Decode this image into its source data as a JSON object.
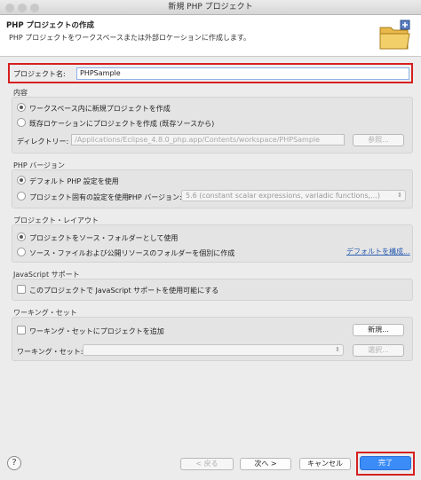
{
  "window": {
    "title": "新規 PHP プロジェクト"
  },
  "header": {
    "title": "PHP プロジェクトの作成",
    "description": "PHP プロジェクトをワークスペースまたは外部ロケーションに作成します。"
  },
  "project_name": {
    "label": "プロジェクト名:",
    "value": "PHPSample"
  },
  "contents": {
    "title": "内容",
    "options": [
      {
        "label": "ワークスペース内に新規プロジェクトを作成",
        "selected": true
      },
      {
        "label": "既存ロケーションにプロジェクトを作成 (既存ソースから)",
        "selected": false
      }
    ],
    "directory_label": "ディレクトリー:",
    "directory_value": "/Applications/Eclipse_4.8.0_php.app/Contents/workspace/PHPSample",
    "browse_label": "参照..."
  },
  "php_version": {
    "title": "PHP バージョン",
    "options": [
      {
        "label": "デフォルト PHP 設定を使用",
        "selected": true
      },
      {
        "label": "プロジェクト固有の設定を使用:",
        "selected": false
      }
    ],
    "version_label": "PHP バージョン:",
    "version_value": "5.6 (constant scalar expressions, variadic functions,...)"
  },
  "layout": {
    "title": "プロジェクト・レイアウト",
    "options": [
      {
        "label": "プロジェクトをソース・フォルダーとして使用",
        "selected": true
      },
      {
        "label": "ソース・ファイルおよび公開リソースのフォルダーを個別に作成",
        "selected": false
      }
    ],
    "configure_link": "デフォルトを構成..."
  },
  "javascript": {
    "title": "JavaScript サポート",
    "checkbox_label": "このプロジェクトで JavaScript サポートを使用可能にする",
    "checked": false
  },
  "working_set": {
    "title": "ワーキング・セット",
    "checkbox_label": "ワーキング・セットにプロジェクトを追加",
    "checked": false,
    "new_button": "新規...",
    "sets_label": "ワーキング・セット:",
    "sets_value": "",
    "select_button": "選択..."
  },
  "footer": {
    "help_icon": "?",
    "back": "< 戻る",
    "next": "次へ >",
    "cancel": "キャンセル",
    "finish": "完了"
  },
  "colors": {
    "highlight_frame": "#d62020",
    "finish_button": "#3b8cf7",
    "link": "#2a5db0"
  }
}
